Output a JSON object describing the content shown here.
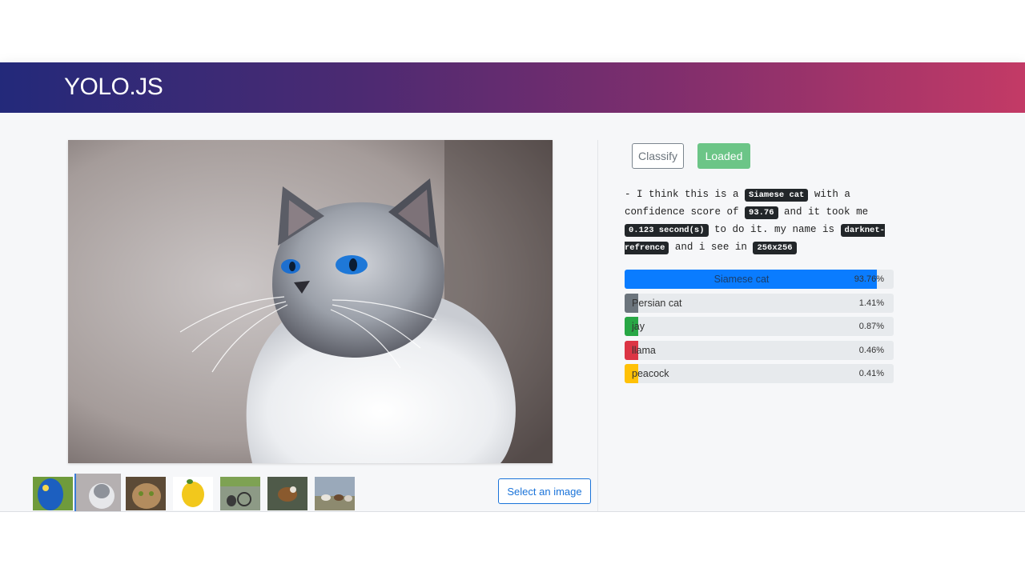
{
  "app": {
    "title": "YOLO.JS"
  },
  "controls": {
    "classify_label": "Classify",
    "loaded_label": "Loaded",
    "select_image_label": "Select an image"
  },
  "description": {
    "p1": "- I think this is a ",
    "label": "Siamese cat",
    "p2": " with a confidence score of ",
    "score": "93.76",
    "p3": " and it took me ",
    "time": "0.123 second(s)",
    "p4": " to do it. my name is ",
    "model": "darknet-refrence",
    "p5": " and i see in ",
    "size": "256x256"
  },
  "predictions": [
    {
      "label": "Siamese cat",
      "percent": "93.76%",
      "value": 93.76,
      "color": "#0a7cff"
    },
    {
      "label": "Persian cat",
      "percent": "1.41%",
      "value": 1.41,
      "color": "#6c757d"
    },
    {
      "label": "jay",
      "percent": "0.87%",
      "value": 0.87,
      "color": "#28a745"
    },
    {
      "label": "llama",
      "percent": "0.46%",
      "value": 0.46,
      "color": "#dc3545"
    },
    {
      "label": "peacock",
      "percent": "0.41%",
      "value": 0.41,
      "color": "#ffc107"
    }
  ],
  "thumbnails": [
    {
      "name": "parrot-thumbnail"
    },
    {
      "name": "siamese-cat-thumbnail",
      "active": true
    },
    {
      "name": "tabby-cat-thumbnail"
    },
    {
      "name": "lemon-thumbnail"
    },
    {
      "name": "dog-bicycle-thumbnail"
    },
    {
      "name": "eagle-thumbnail"
    },
    {
      "name": "horses-thumbnail"
    }
  ]
}
